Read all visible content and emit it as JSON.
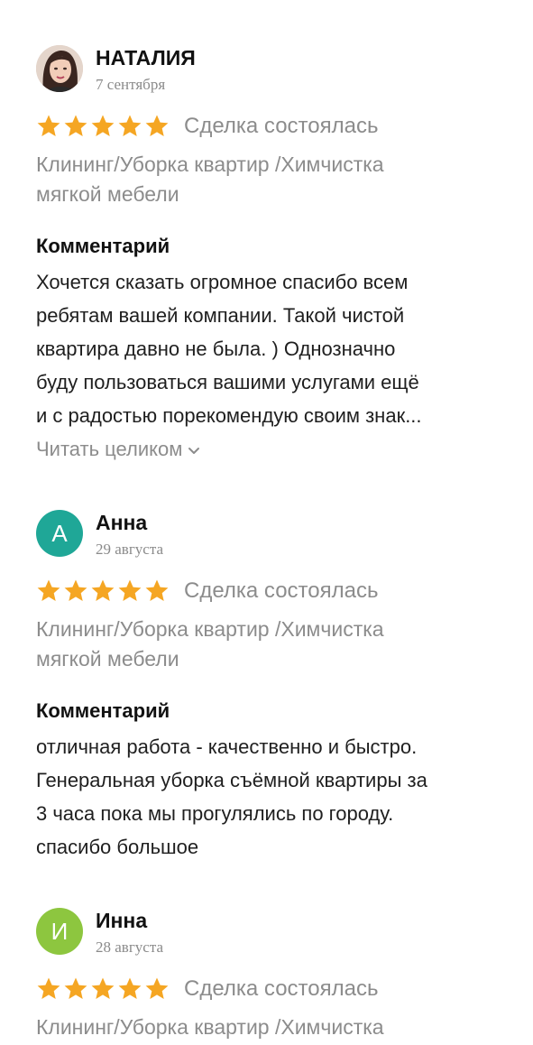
{
  "reviews": [
    {
      "author": "НАТАЛИЯ",
      "date": "7 сентября",
      "avatar_type": "photo",
      "rating": 5,
      "deal_status": "Сделка состоялась",
      "category_line1": "Клининг/Уборка квартир /Химчистка",
      "category_line2": "мягкой мебели",
      "comment_title": "Комментарий",
      "comment_lines": [
        "Хочется сказать огромное спасибо всем",
        "ребятам вашей компании. Такой чистой",
        "квартира давно не была. ) Однозначно",
        "буду пользоваться вашими услугами ещё",
        "и с радостью порекомендую своим знак..."
      ],
      "read_more": "Читать целиком"
    },
    {
      "author": "Анна",
      "date": "29 августа",
      "avatar_type": "letter",
      "avatar_letter": "А",
      "avatar_color": "#1fa797",
      "rating": 5,
      "deal_status": "Сделка состоялась",
      "category_line1": "Клининг/Уборка квартир /Химчистка",
      "category_line2": "мягкой мебели",
      "comment_title": "Комментарий",
      "comment_lines": [
        "отличная работа - качественно и быстро.",
        "Генеральная уборка съёмной квартиры за",
        "3 часа пока мы прогулялись по городу.",
        "спасибо большое"
      ]
    },
    {
      "author": "Инна",
      "date": "28 августа",
      "avatar_type": "letter",
      "avatar_letter": "И",
      "avatar_color": "#8dc63f",
      "rating": 5,
      "deal_status": "Сделка состоялась",
      "category_line1": "Клининг/Уборка квартир /Химчистка"
    }
  ],
  "colors": {
    "star": "#f5a623",
    "muted_text": "#8c8c8c"
  },
  "icons": {
    "star": "star-icon",
    "chevron": "chevron-down-icon"
  }
}
